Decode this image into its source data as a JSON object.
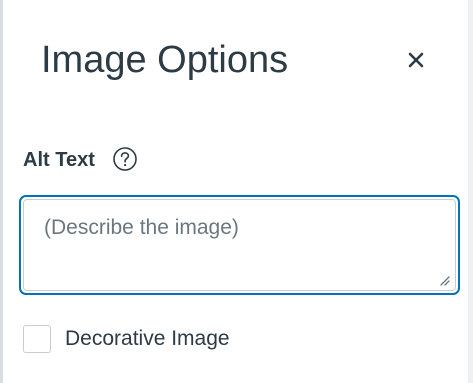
{
  "tray": {
    "title": "Image Options",
    "close_icon": "close-icon"
  },
  "alt_text": {
    "label": "Alt Text",
    "help_icon": "question-circle-icon",
    "value": "",
    "placeholder": "(Describe the image)"
  },
  "decorative": {
    "label": "Decorative Image",
    "checked": false
  },
  "colors": {
    "text": "#2d3b45",
    "focus_border": "#0374b5",
    "input_border": "#c7cdd1",
    "placeholder": "#6b7780"
  }
}
